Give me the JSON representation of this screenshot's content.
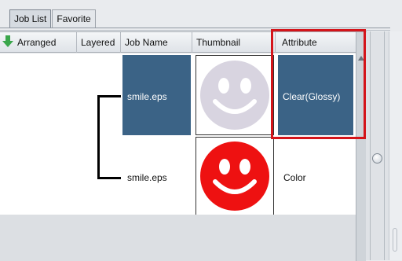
{
  "tabs": [
    {
      "label": "Job List",
      "active": true
    },
    {
      "label": "Favorite",
      "active": false
    }
  ],
  "table": {
    "columns": [
      "Arranged",
      "Layered",
      "Job Name",
      "Thumbnail",
      "Attribute"
    ],
    "rows": [
      {
        "job_name": "smile.eps",
        "thumbnail": "smile-icon-pale",
        "attribute": "Clear(Glossy)",
        "selected": true
      },
      {
        "job_name": "smile.eps",
        "thumbnail": "smile-icon-red",
        "attribute": "Color",
        "selected": false
      }
    ]
  },
  "colors": {
    "selection": "#3b6386",
    "highlight": "#d4141a",
    "smile_pale": "#d8d4e0",
    "smile_red": "#ee1111"
  }
}
